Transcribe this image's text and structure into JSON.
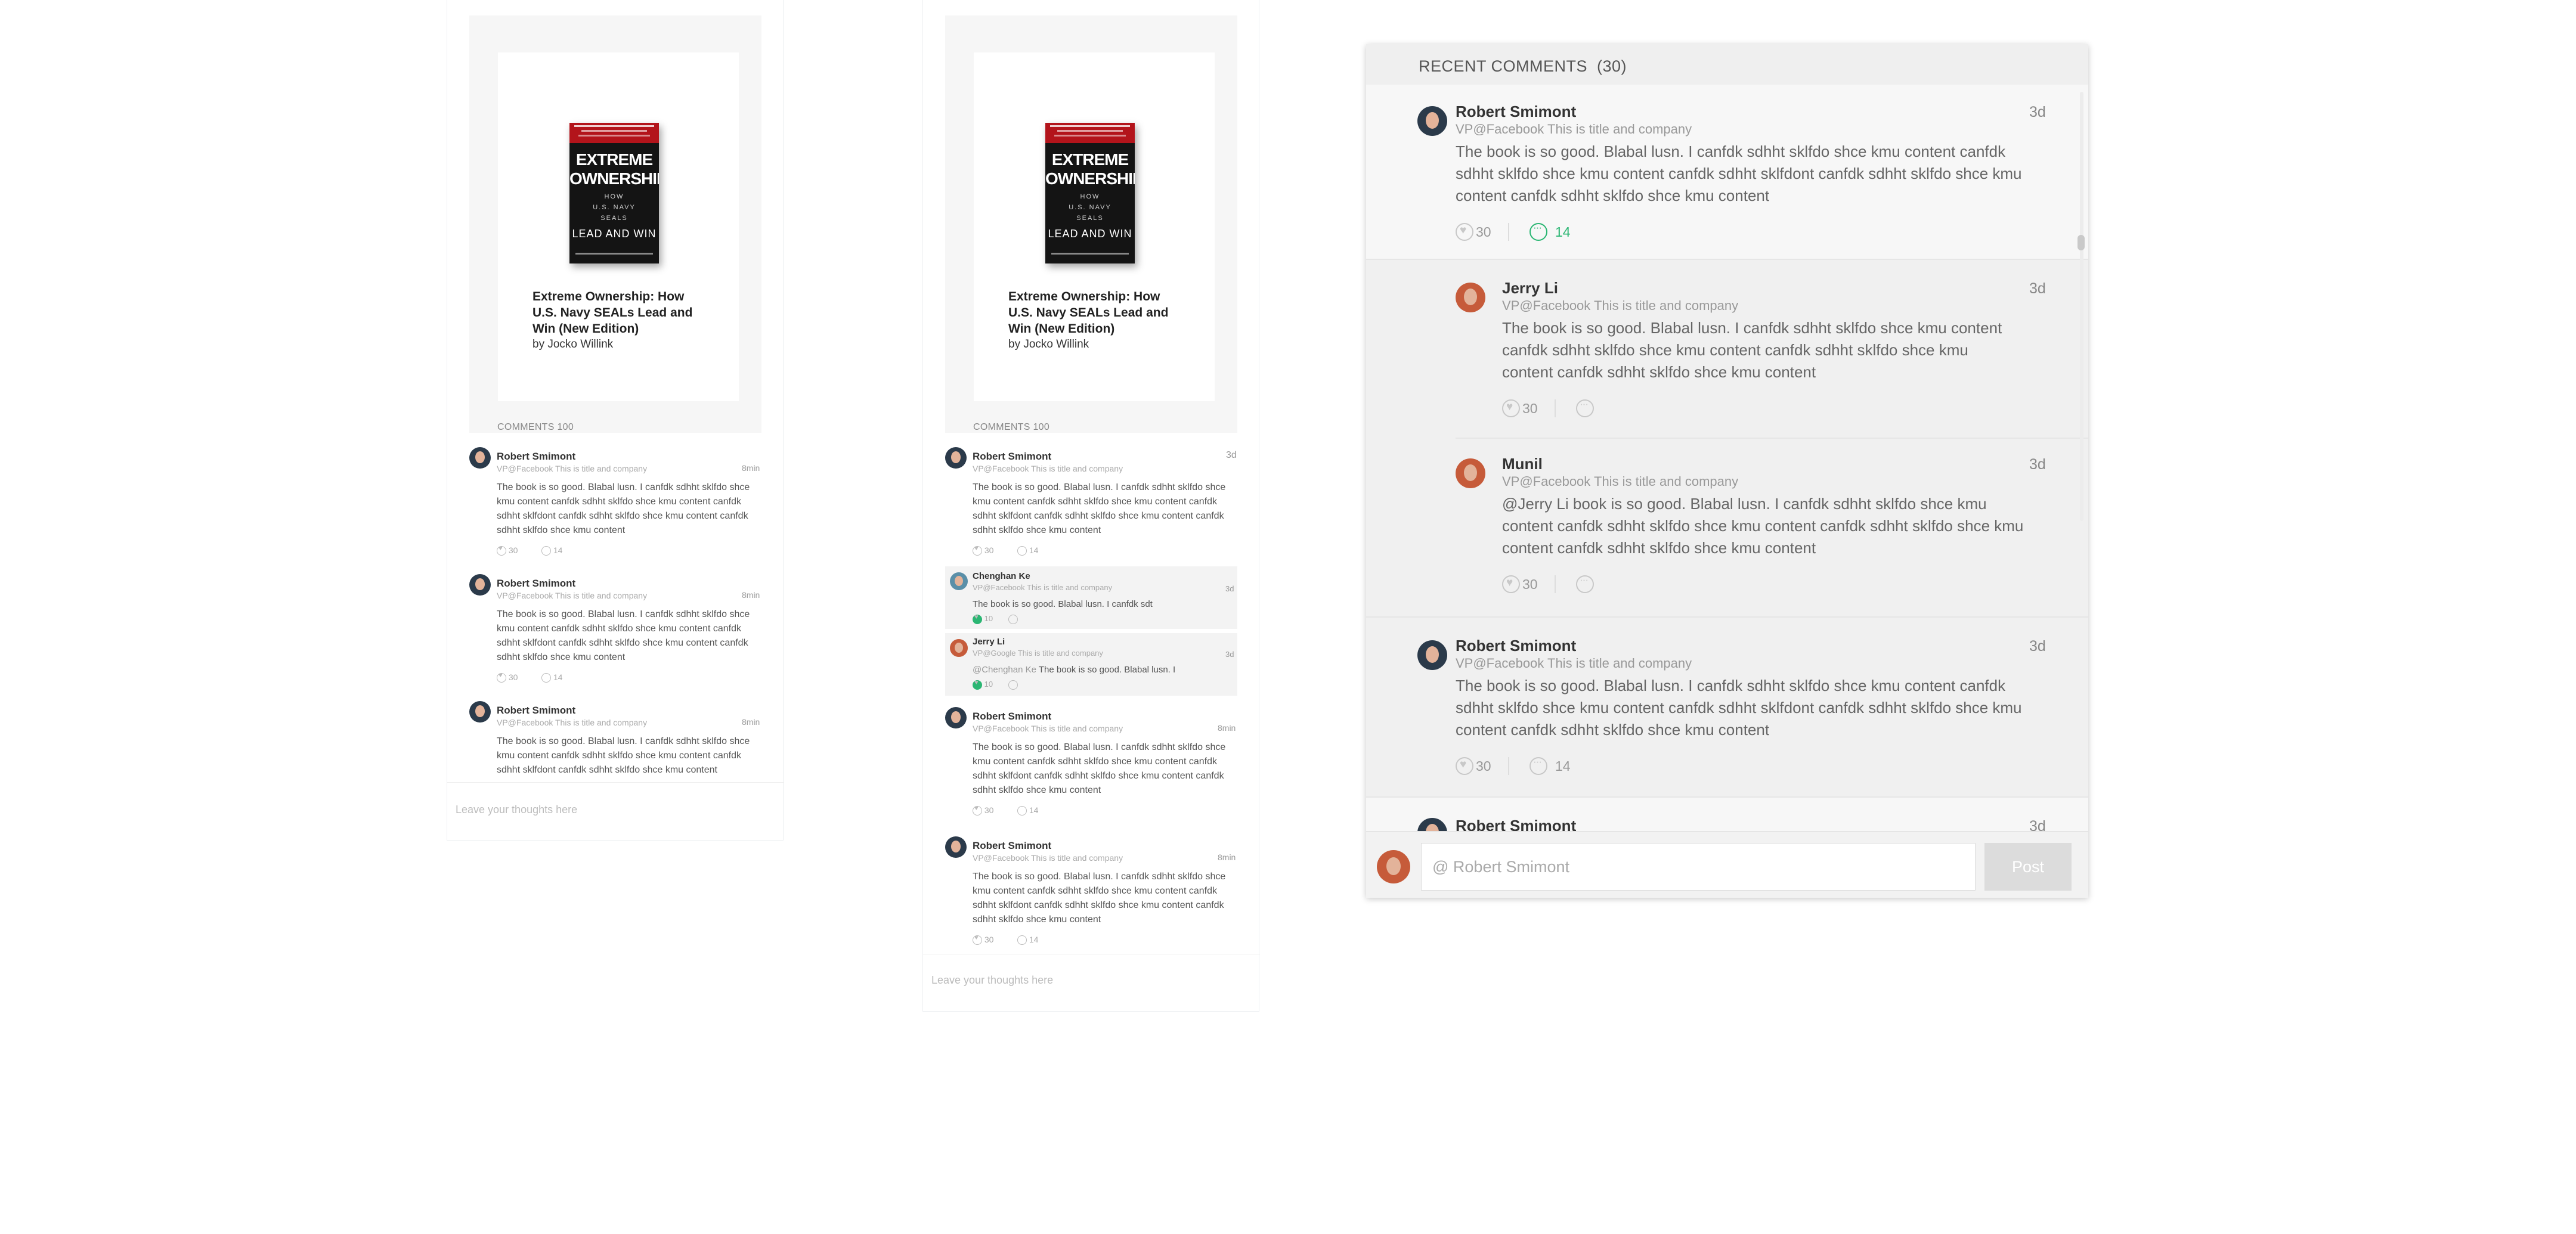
{
  "book": {
    "cover_line1": "EXTREME",
    "cover_line2": "OWNERSHIP",
    "cover_how": "HOW",
    "cover_usnavy": "U.S. NAVY",
    "cover_seals": "SEALS",
    "cover_lead": "LEAD AND WIN",
    "title": "Extreme Ownership: How U.S. Navy SEALs Lead and Win (New Edition)",
    "author": "by Jocko Willink"
  },
  "panel1": {
    "comments_label": "COMMENTS 100",
    "comments": [
      {
        "name": "Robert Smimont",
        "sub": "VP@Facebook This is title and company",
        "time": "8min",
        "body": "The book is so good. Blabal lusn. I canfdk sdhht sklfdo shce kmu content  canfdk sdhht sklfdo shce kmu content canfdk sdhht sklfdont  canfdk sdhht sklfdo shce kmu content  canfdk sdhht sklfdo shce kmu content",
        "likes": "30",
        "replies": "14"
      },
      {
        "name": "Robert Smimont",
        "sub": "VP@Facebook This is title and company",
        "time": "8min",
        "body": "The book is so good. Blabal lusn. I canfdk sdhht sklfdo shce kmu content  canfdk sdhht sklfdo shce kmu content canfdk sdhht sklfdont  canfdk sdhht sklfdo shce kmu content  canfdk sdhht sklfdo shce kmu content",
        "likes": "30",
        "replies": "14"
      },
      {
        "name": "Robert Smimont",
        "sub": "VP@Facebook This is title and company",
        "time": "8min",
        "body": "The book is so good. Blabal lusn. I canfdk sdhht sklfdo shce kmu content  canfdk sdhht sklfdo shce kmu content canfdk sdhht sklfdont  canfdk sdhht sklfdo shce kmu content",
        "likes": "",
        "replies": ""
      }
    ],
    "input_placeholder": "Leave your thoughts here"
  },
  "panel2": {
    "comments_label": "COMMENTS 100",
    "first": {
      "name": "Robert Smimont",
      "sub": "VP@Facebook This is title and company",
      "time": "3d",
      "body": "The book is so good. Blabal lusn. I canfdk sdhht sklfdo shce kmu content  canfdk sdhht sklfdo shce kmu content canfdk sdhht sklfdont  canfdk sdhht sklfdo shce kmu content  canfdk sdhht sklfdo shce kmu content",
      "likes": "30",
      "replies": "14"
    },
    "reply1": {
      "name": "Chenghan Ke",
      "sub": "VP@Facebook This is title and company",
      "time": "3d",
      "body": "The book is so good. Blabal lusn. I canfdk sdt",
      "likes": "10"
    },
    "reply2": {
      "name": "Jerry Li",
      "sub": "VP@Google This is title and company",
      "time": "3d",
      "mention": "@Chenghan Ke",
      "body": " The book is so good. Blabal lusn. I",
      "likes": "10"
    },
    "comments": [
      {
        "name": "Robert Smimont",
        "sub": "VP@Facebook This is title and company",
        "time": "8min",
        "body": "The book is so good. Blabal lusn. I canfdk sdhht sklfdo shce kmu content  canfdk sdhht sklfdo shce kmu content canfdk sdhht sklfdont  canfdk sdhht sklfdo shce kmu content  canfdk sdhht sklfdo shce kmu content",
        "likes": "30",
        "replies": "14"
      },
      {
        "name": "Robert Smimont",
        "sub": "VP@Facebook This is title and company",
        "time": "8min",
        "body": "The book is so good. Blabal lusn. I canfdk sdhht sklfdo shce kmu content  canfdk sdhht sklfdo shce kmu content canfdk sdhht sklfdont  canfdk sdhht sklfdo shce kmu content  canfdk sdhht sklfdo shce kmu content",
        "likes": "30",
        "replies": "14"
      }
    ],
    "input_placeholder": "Leave your thoughts here"
  },
  "panel3": {
    "title": "RECENT COMMENTS",
    "count": "(30)",
    "comments": [
      {
        "name": "Robert Smimont",
        "sub": "VP@Facebook This is title and company",
        "time": "3d",
        "body": "The book is so good. Blabal lusn. I canfdk sdhht sklfdo shce kmu content  canfdk sdhht sklfdo shce kmu content   canfdk sdhht sklfdont  canfdk sdhht sklfdo shce kmu content  canfdk sdhht sklfdo shce kmu content",
        "likes": "30",
        "replies": "14"
      },
      {
        "name": "Jerry Li",
        "sub": "VP@Facebook This is title and company",
        "time": "3d",
        "body": "The book is so good. Blabal lusn. I canfdk sdhht sklfdo shce kmu content canfdk sdhht sklfdo shce kmu content    canfdk sdhht sklfdo shce kmu content  canfdk sdhht sklfdo shce kmu content",
        "likes": "30"
      },
      {
        "name": "Munil",
        "sub": "VP@Facebook This is title and company",
        "time": "3d",
        "body": "@Jerry Li book is so good. Blabal lusn. I canfdk sdhht sklfdo shce kmu content  canfdk sdhht sklfdo shce kmu content    canfdk sdhht sklfdo shce kmu content  canfdk sdhht sklfdo shce kmu content",
        "likes": "30"
      },
      {
        "name": "Robert Smimont",
        "sub": "VP@Facebook This is title and company",
        "time": "3d",
        "body": "The book is so good. Blabal lusn. I canfdk sdhht sklfdo shce kmu content  canfdk sdhht sklfdo shce kmu content   canfdk sdhht sklfdont  canfdk sdhht sklfdo shce kmu content  canfdk sdhht sklfdo shce kmu content",
        "likes": "30",
        "replies": "14"
      },
      {
        "name": "Robert Smimont",
        "time": "3d"
      }
    ],
    "input_placeholder": "@ Robert Smimont",
    "post_label": "Post"
  },
  "colors": {
    "accent_green": "#2bb673",
    "cover_red": "#b3141b"
  }
}
